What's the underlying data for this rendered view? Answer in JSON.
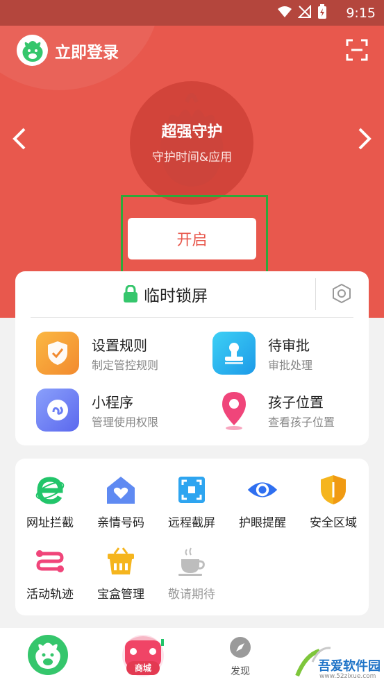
{
  "status_bar": {
    "time": "9:15"
  },
  "header": {
    "login_label": "立即登录"
  },
  "hero": {
    "title": "超强守护",
    "subtitle": "守护时间&应用",
    "action_label": "开启"
  },
  "lock_card": {
    "label": "临时锁屏",
    "features": [
      {
        "title": "设置规则",
        "subtitle": "制定管控规则",
        "icon": "shield-check-icon",
        "color": "#f7a73b"
      },
      {
        "title": "待审批",
        "subtitle": "审批处理",
        "icon": "stamp-icon",
        "color": "#2fb4f0"
      },
      {
        "title": "小程序",
        "subtitle": "管理使用权限",
        "icon": "mini-program-icon",
        "color": "#6a7ef5"
      },
      {
        "title": "孩子位置",
        "subtitle": "查看孩子位置",
        "icon": "location-pin-icon",
        "color": "#f0457a"
      }
    ]
  },
  "tools": [
    {
      "label": "网址拦截",
      "icon": "browser-e-icon"
    },
    {
      "label": "亲情号码",
      "icon": "home-heart-icon"
    },
    {
      "label": "远程截屏",
      "icon": "screenshot-icon"
    },
    {
      "label": "护眼提醒",
      "icon": "eye-icon"
    },
    {
      "label": "安全区域",
      "icon": "shield-icon"
    },
    {
      "label": "活动轨迹",
      "icon": "track-icon"
    },
    {
      "label": "宝盒管理",
      "icon": "basket-icon"
    },
    {
      "label": "敬请期待",
      "icon": "coffee-icon"
    }
  ],
  "bottom_nav": {
    "mall_label": "商城",
    "discover_label": "发现"
  },
  "watermark": {
    "title": "吾爱软件园",
    "url": "www.52zixue.com"
  }
}
